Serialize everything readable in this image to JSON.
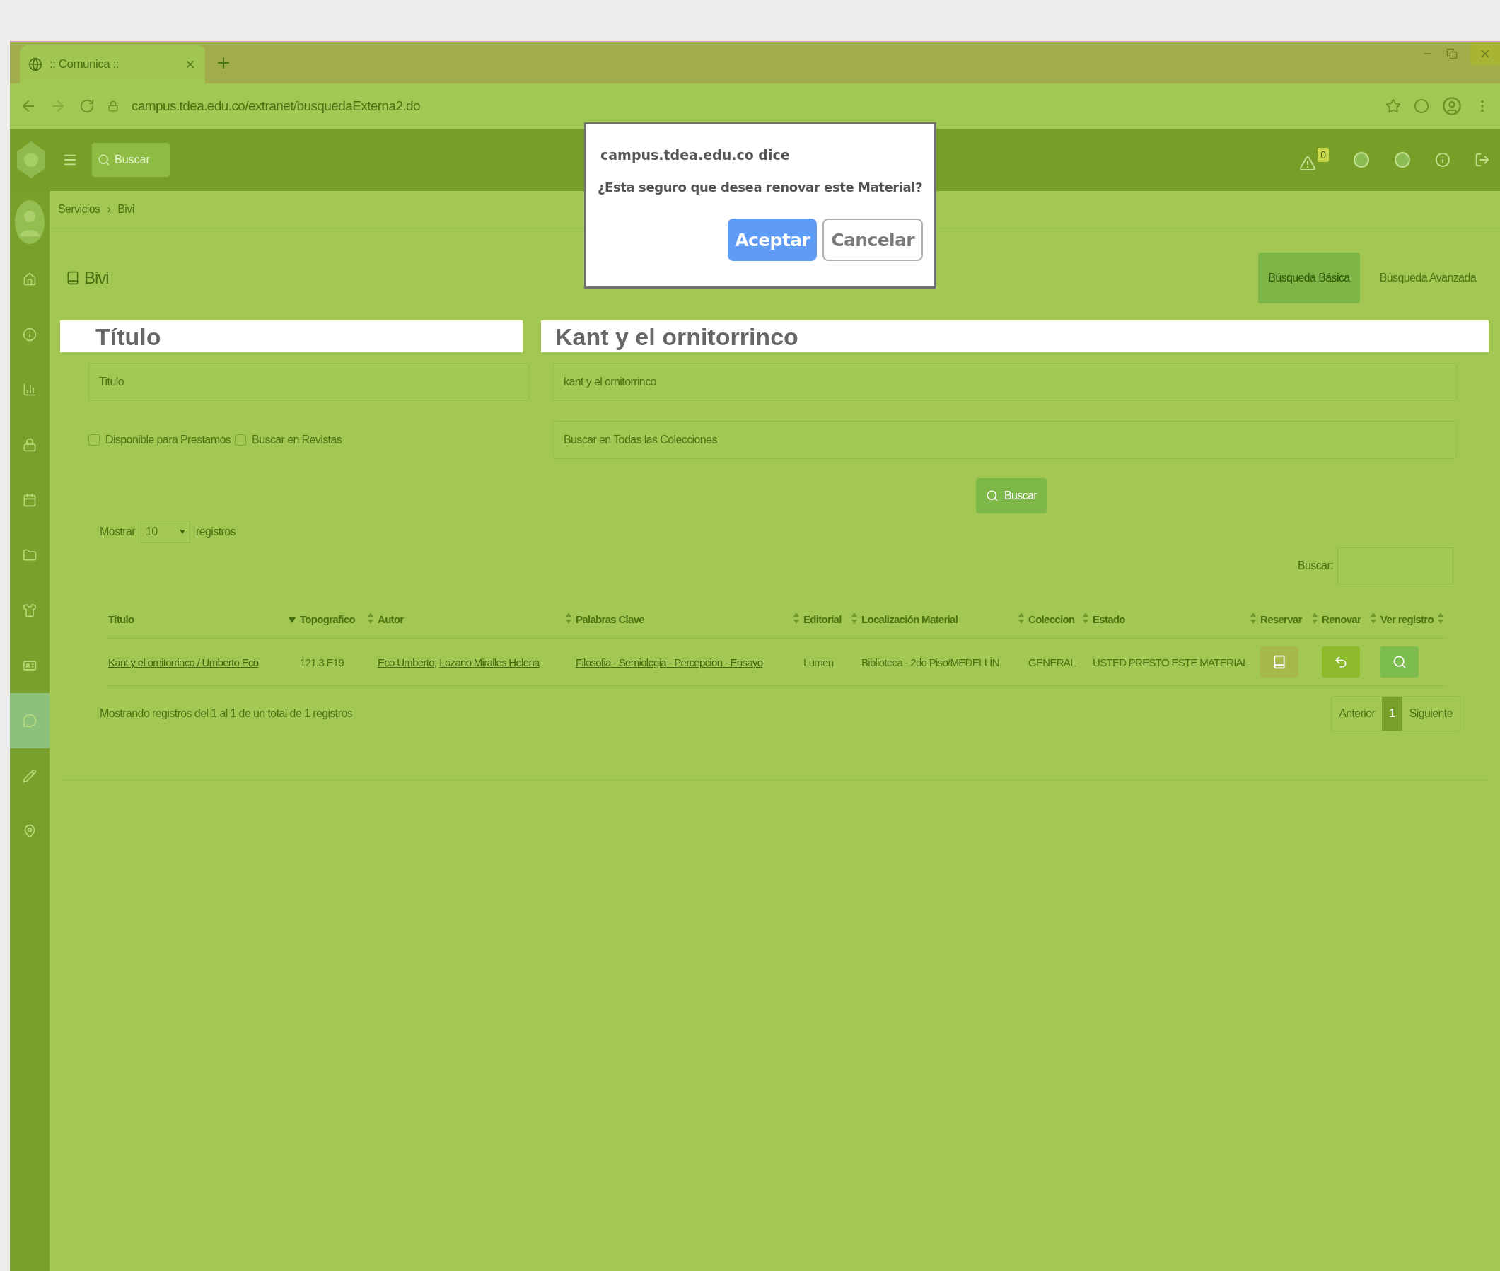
{
  "browser": {
    "tab_title": ":: Comunica ::",
    "url": "campus.tdea.edu.co/extranet/busquedaExterna2.do"
  },
  "header": {
    "search_placeholder": "Buscar",
    "alert_count": "0"
  },
  "sidebar": {
    "items": [
      {
        "selected": false
      },
      {
        "selected": false
      },
      {
        "selected": false
      },
      {
        "selected": false
      },
      {
        "selected": false
      },
      {
        "selected": false
      },
      {
        "selected": false
      },
      {
        "selected": false
      },
      {
        "selected": true
      },
      {
        "selected": false
      },
      {
        "selected": false
      }
    ]
  },
  "breadcrumb": {
    "items": [
      "Servicios",
      "Bivi"
    ],
    "separator": "›"
  },
  "page_title": "Bivi",
  "mode_tabs": [
    {
      "label": "Búsqueda Básica",
      "selected": true
    },
    {
      "label": "Búsqueda Avanzada",
      "selected": false
    }
  ],
  "highlight_bands": [
    "Título",
    "Kant y el ornitorrinco"
  ],
  "form": {
    "field": "Titulo",
    "query": "kant y el ornitorrinco",
    "checkboxes": [
      {
        "label": "Disponible para Prestamos",
        "checked": false
      },
      {
        "label": "Buscar en Revistas",
        "checked": false
      }
    ],
    "collection_placeholder": "Buscar en Todas las Colecciones",
    "search_button": "Buscar"
  },
  "table_controls": {
    "show_label": "Mostrar",
    "page_size": "10",
    "records_label": "registros",
    "filter_label": "Buscar:"
  },
  "table": {
    "columns": [
      {
        "label": "Titulo",
        "sorted": true
      },
      {
        "label": "Topografico",
        "sorted": false
      },
      {
        "label": "Autor",
        "sorted": false
      },
      {
        "label": "Palabras Clave",
        "sorted": false
      },
      {
        "label": "Editorial",
        "sorted": false
      },
      {
        "label": "Localización Material",
        "sorted": false
      },
      {
        "label": "Coleccion",
        "sorted": false
      },
      {
        "label": "Estado",
        "sorted": false
      },
      {
        "label": "Reservar",
        "sorted": false
      },
      {
        "label": "Renovar",
        "sorted": false
      },
      {
        "label": "Ver registro",
        "sorted": false
      }
    ],
    "rows": [
      {
        "title": "Kant y el ornitorrinco / Umberto Eco",
        "topografico": "121.3 E19",
        "authors": [
          "Eco Umberto",
          "Lozano Miralles Helena"
        ],
        "author_separator": ";",
        "keywords": "Filosofia - Semiologia - Percepcion - Ensayo",
        "editorial": "Lumen",
        "location": "Biblioteca - 2do Piso/MEDELLÍN",
        "collection": "GENERAL",
        "status": "USTED PRESTO ESTE MATERIAL",
        "actions": [
          {
            "kind": "reserve"
          },
          {
            "kind": "renew"
          },
          {
            "kind": "view"
          }
        ]
      }
    ]
  },
  "footer": {
    "info": "Mostrando registros del 1 al 1 de un total de 1 registros",
    "pagination": [
      {
        "label": "Anterior",
        "selected": false
      },
      {
        "label": "1",
        "selected": true
      },
      {
        "label": "Siguiente",
        "selected": false
      }
    ]
  },
  "dialog": {
    "origin": "campus.tdea.edu.co dice",
    "message": "¿Esta seguro que desea renovar este Material?",
    "buttons": [
      {
        "label": "Aceptar",
        "kind": "primary"
      },
      {
        "label": "Cancelar",
        "kind": "secondary"
      }
    ]
  }
}
